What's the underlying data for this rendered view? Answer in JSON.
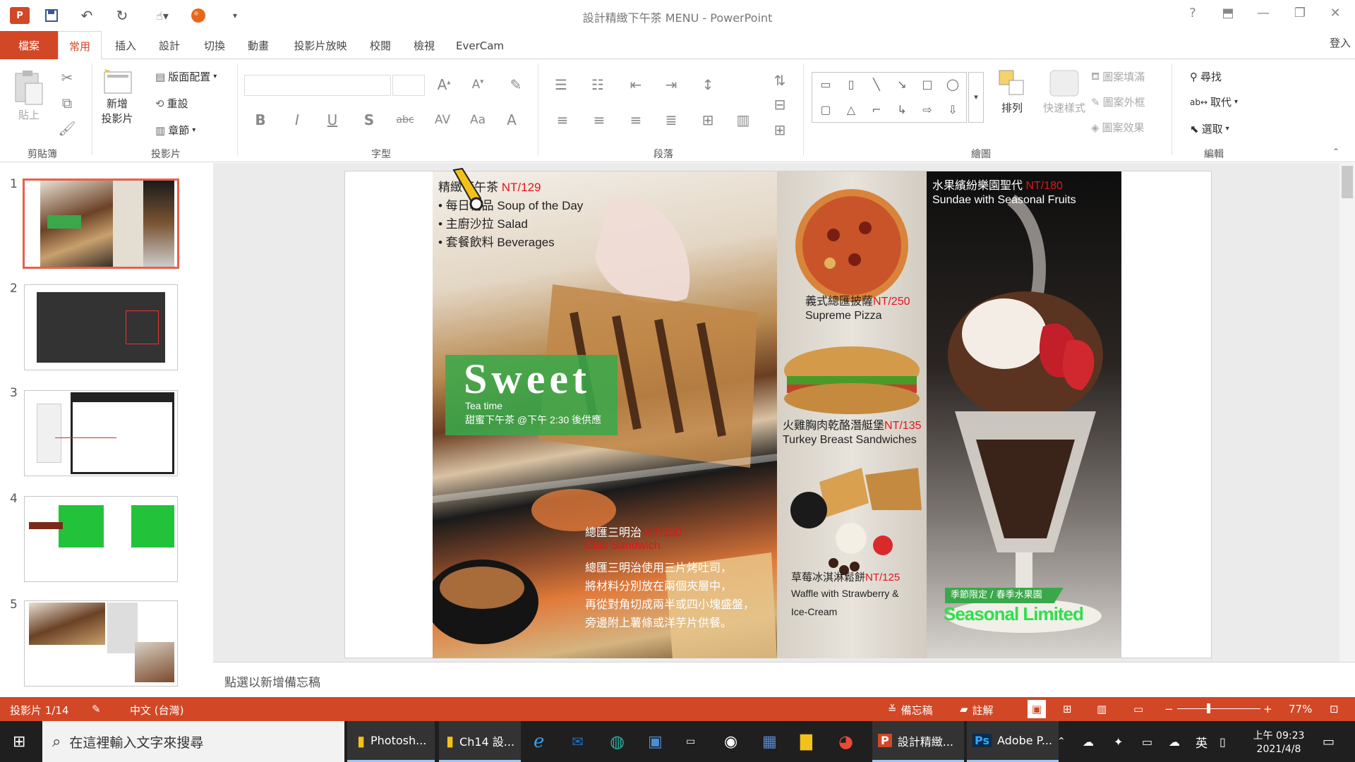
{
  "window": {
    "title": "設計精緻下午茶 MENU - PowerPoint",
    "help": "?",
    "login": "登入"
  },
  "tabs": [
    "檔案",
    "常用",
    "插入",
    "設計",
    "切換",
    "動畫",
    "投影片放映",
    "校閱",
    "檢視",
    "EverCam"
  ],
  "ribbon": {
    "clipboard": {
      "label": "剪貼簿",
      "paste": "貼上"
    },
    "slides": {
      "label": "投影片",
      "new_slide_1": "新增",
      "new_slide_2": "投影片",
      "layout": "版面配置",
      "reset": "重設",
      "section": "章節"
    },
    "font": {
      "label": "字型"
    },
    "paragraph": {
      "label": "段落"
    },
    "drawing": {
      "label": "繪圖",
      "arrange": "排列",
      "quick_styles": "快速樣式",
      "shape_fill": "圖案填滿",
      "shape_outline": "圖案外框",
      "shape_effects": "圖案效果"
    },
    "editing": {
      "label": "編輯",
      "find": "尋找",
      "replace": "取代",
      "select": "選取"
    },
    "format_letters": [
      "B",
      "I",
      "U",
      "S",
      "abc",
      "AV",
      "Aa",
      "A"
    ]
  },
  "slides": [
    {
      "num": "1",
      "selected": true
    },
    {
      "num": "2",
      "selected": false
    },
    {
      "num": "3",
      "selected": false
    },
    {
      "num": "4",
      "selected": false
    },
    {
      "num": "5",
      "selected": false
    }
  ],
  "slide": {
    "set_title": "精緻下午茶",
    "set_price": "NT/129",
    "set_items": [
      "• 每日精品 Soup of the Day",
      "• 主廚沙拉 Salad",
      "• 套餐飲料 Beverages"
    ],
    "sweet_big": "Sweet",
    "sweet_sub1": "Tea time",
    "sweet_sub2": "甜蜜下午茶 @下午 2:30 後供應",
    "club_title": "總匯三明治",
    "club_price": "NT/150",
    "club_en": "Club Sandwich",
    "club_desc": [
      "總匯三明治使用三片烤吐司，",
      "將材料分別放在兩個夾層中，",
      "再從對角切成兩半或四小塊盛盤，",
      "旁邊附上薯條或洋芋片供餐。"
    ],
    "pizza_title": "義式總匯披薩",
    "pizza_price": "NT/250",
    "pizza_en": "Supreme Pizza",
    "sub_title": "火雞胸肉乾酪潛艇堡",
    "sub_price": "NT/135",
    "sub_en": "Turkey Breast Sandwiches",
    "waffle_title": "草莓冰淇淋鬆餅",
    "waffle_price": "NT/125",
    "waffle_en1": "Waffle with Strawberry &",
    "waffle_en2": "Ice-Cream",
    "sundae_title": "水果繽紛樂園聖代",
    "sundae_price": "NT/180",
    "sundae_en": "Sundae with Seasonal Fruits",
    "season_tag": "季節限定 / 春季水果園",
    "season_big": "Seasonal Limited"
  },
  "notes_placeholder": "點選以新增備忘稿",
  "status": {
    "slide_pos": "投影片 1/14",
    "language": "中文 (台灣)",
    "notes": "備忘稿",
    "comments": "註解",
    "zoom": "77%",
    "zoom_value": 0.77
  },
  "taskbar": {
    "search": "在這裡輸入文字來搜尋",
    "apps": [
      "Photosh...",
      "Ch14 設...",
      "設計精緻...",
      "Adobe P..."
    ],
    "ime": "英",
    "time": "上午 09:23",
    "date": "2021/4/8"
  },
  "colors": {
    "accent": "#d24726",
    "price_red": "#e0161b",
    "sweet_green": "#3aa84a"
  }
}
